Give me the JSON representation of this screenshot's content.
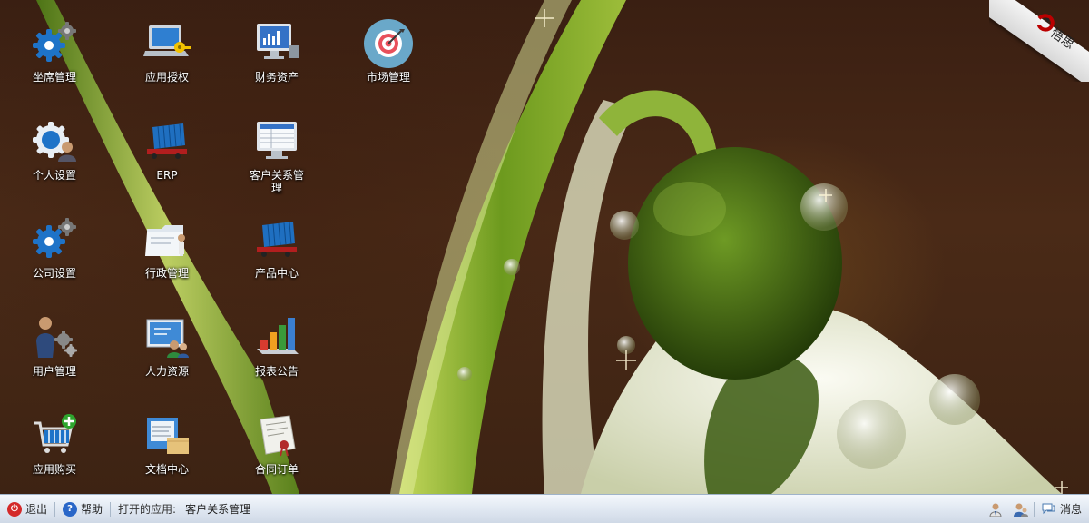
{
  "desktop": {
    "icons": [
      {
        "label": "坐席管理",
        "icon": "gear-icon"
      },
      {
        "label": "应用授权",
        "icon": "laptop-key-icon"
      },
      {
        "label": "财务资产",
        "icon": "monitor-chart-icon"
      },
      {
        "label": "市场管理",
        "icon": "target-icon"
      },
      {
        "label": "个人设置",
        "icon": "gear-user-icon"
      },
      {
        "label": "ERP",
        "icon": "container-truck-icon"
      },
      {
        "label": "客户关系管理",
        "icon": "monitor-table-icon"
      },
      {
        "label": "公司设置",
        "icon": "gear-icon"
      },
      {
        "label": "行政管理",
        "icon": "folder-user-icon"
      },
      {
        "label": "产品中心",
        "icon": "container-truck-icon"
      },
      {
        "label": "用户管理",
        "icon": "user-gears-icon"
      },
      {
        "label": "人力资源",
        "icon": "board-users-icon"
      },
      {
        "label": "报表公告",
        "icon": "bar-chart-icon"
      },
      {
        "label": "应用购买",
        "icon": "cart-add-icon"
      },
      {
        "label": "文档中心",
        "icon": "document-folder-icon"
      },
      {
        "label": "合同订单",
        "icon": "contract-icon"
      }
    ],
    "corner_logo": "悟思"
  },
  "taskbar": {
    "logout_label": "退出",
    "help_label": "帮助",
    "open_apps_label": "打开的应用:",
    "open_app": "客户关系管理",
    "messages_label": "消息"
  },
  "colors": {
    "taskbar_top": "#f4f8fc",
    "taskbar_bottom": "#cfd9e6",
    "label_text": "#ffffff",
    "gear_blue": "#1e73c8"
  }
}
